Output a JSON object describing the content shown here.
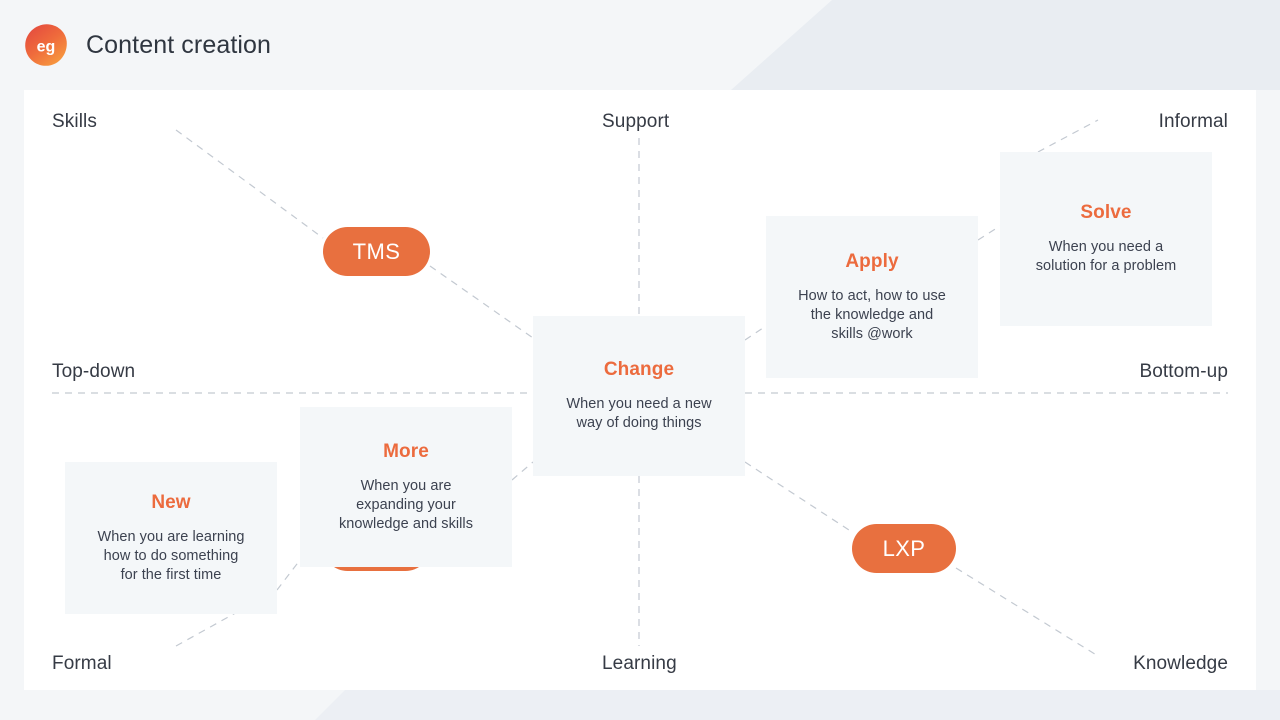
{
  "header": {
    "logo_text": "eg",
    "logo_name": "eg-logo",
    "title": "Content creation"
  },
  "colors": {
    "accent": "#ec6b3e",
    "pill": "#e8703f",
    "card_bg": "#f4f7f9",
    "page_bg": "#f4f6f8",
    "panel_bg": "#ffffff",
    "text": "#363b45",
    "dashed_line": "#c3c9d1"
  },
  "chart_data": {
    "type": "diagram",
    "title": "Content creation",
    "axes": {
      "top_left": "Skills",
      "top_center": "Support",
      "top_right": "Informal",
      "middle_left": "Top-down",
      "middle_right": "Bottom-up",
      "bottom_left": "Formal",
      "bottom_center": "Learning",
      "bottom_right": "Knowledge"
    },
    "cards": [
      {
        "id": "new",
        "title": "New",
        "body": "When you are learning how to do something for the first time",
        "quadrant": "bottom-left"
      },
      {
        "id": "more",
        "title": "More",
        "body": "When you are expanding your knowledge and skills",
        "quadrant": "bottom-left-inner"
      },
      {
        "id": "change",
        "title": "Change",
        "body": "When you need a new way of doing things",
        "quadrant": "center"
      },
      {
        "id": "apply",
        "title": "Apply",
        "body": "How to act, how to use the knowledge and skills @work",
        "quadrant": "top-right-inner"
      },
      {
        "id": "solve",
        "title": "Solve",
        "body": "When you need a solution for a problem",
        "quadrant": "top-right"
      }
    ],
    "pills": [
      {
        "id": "tms",
        "label": "TMS"
      },
      {
        "id": "hidden",
        "label": ""
      },
      {
        "id": "lxp",
        "label": "LXP"
      }
    ]
  },
  "axis_labels": {
    "skills": "Skills",
    "support": "Support",
    "informal": "Informal",
    "topdown": "Top-down",
    "bottomup": "Bottom-up",
    "formal": "Formal",
    "learning": "Learning",
    "knowledge": "Knowledge"
  },
  "cards": {
    "solve": {
      "title": "Solve",
      "line1": "When you need a",
      "line2": "solution for a problem"
    },
    "apply": {
      "title": "Apply",
      "line1": "How to act, how to use",
      "line2": "the knowledge and",
      "line3": "skills @work"
    },
    "change": {
      "title": "Change",
      "line1": "When you need a new",
      "line2": "way of doing things"
    },
    "more": {
      "title": "More",
      "line1": "When you are",
      "line2": "expanding your",
      "line3": "knowledge and skills"
    },
    "new": {
      "title": "New",
      "line1": "When you are learning",
      "line2": "how to do something",
      "line3": "for the first time"
    }
  },
  "pills": {
    "tms": "TMS",
    "lxp": "LXP",
    "hidden": ""
  }
}
